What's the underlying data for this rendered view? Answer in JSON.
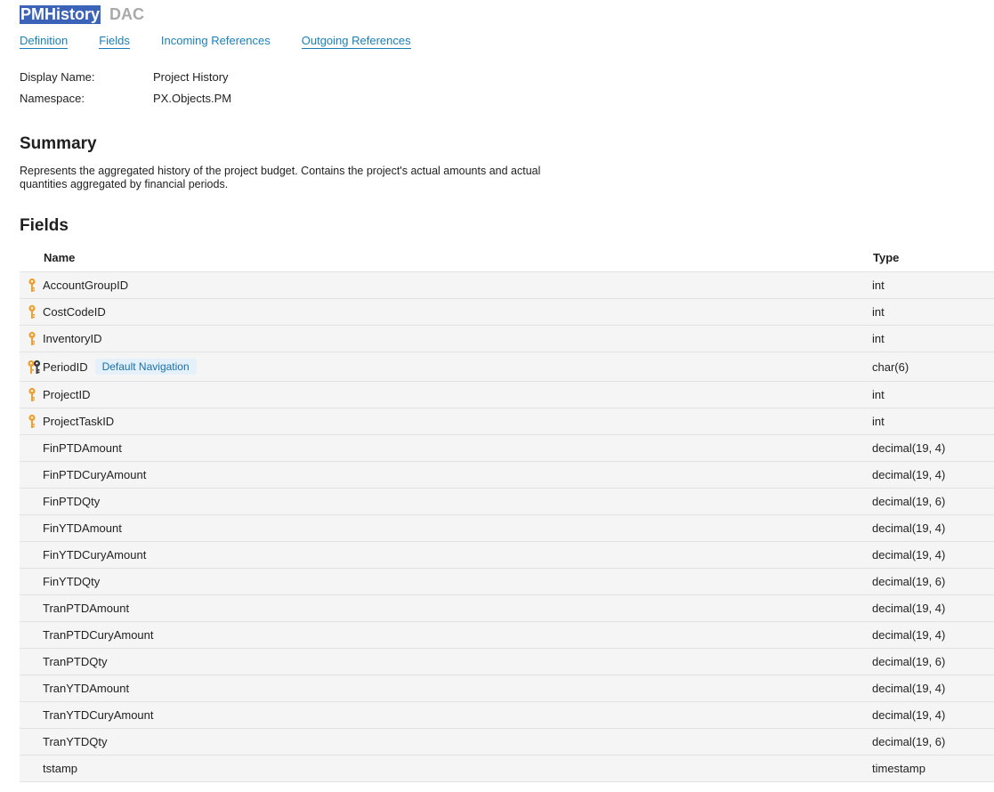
{
  "header": {
    "title": "PMHistory",
    "kind": "DAC"
  },
  "nav": [
    {
      "label": "Definition"
    },
    {
      "label": "Fields"
    },
    {
      "label": "Incoming References"
    },
    {
      "label": "Outgoing References"
    }
  ],
  "properties": {
    "display_name_label": "Display Name:",
    "display_name_value": "Project History",
    "namespace_label": "Namespace:",
    "namespace_value": "PX.Objects.PM"
  },
  "summary": {
    "heading": "Summary",
    "text": "Represents the aggregated history of the project budget. Contains the project's actual amounts and actual quantities aggregated by financial periods."
  },
  "fields": {
    "heading": "Fields",
    "columns": {
      "name": "Name",
      "type": "Type"
    },
    "rows": [
      {
        "name": "AccountGroupID",
        "type": "int",
        "key": "single"
      },
      {
        "name": "CostCodeID",
        "type": "int",
        "key": "single"
      },
      {
        "name": "InventoryID",
        "type": "int",
        "key": "single"
      },
      {
        "name": "PeriodID",
        "type": "char(6)",
        "key": "double",
        "badge": "Default Navigation"
      },
      {
        "name": "ProjectID",
        "type": "int",
        "key": "single"
      },
      {
        "name": "ProjectTaskID",
        "type": "int",
        "key": "single"
      },
      {
        "name": "FinPTDAmount",
        "type": "decimal(19, 4)"
      },
      {
        "name": "FinPTDCuryAmount",
        "type": "decimal(19, 4)"
      },
      {
        "name": "FinPTDQty",
        "type": "decimal(19, 6)"
      },
      {
        "name": "FinYTDAmount",
        "type": "decimal(19, 4)"
      },
      {
        "name": "FinYTDCuryAmount",
        "type": "decimal(19, 4)"
      },
      {
        "name": "FinYTDQty",
        "type": "decimal(19, 6)"
      },
      {
        "name": "TranPTDAmount",
        "type": "decimal(19, 4)"
      },
      {
        "name": "TranPTDCuryAmount",
        "type": "decimal(19, 4)"
      },
      {
        "name": "TranPTDQty",
        "type": "decimal(19, 6)"
      },
      {
        "name": "TranYTDAmount",
        "type": "decimal(19, 4)"
      },
      {
        "name": "TranYTDCuryAmount",
        "type": "decimal(19, 4)"
      },
      {
        "name": "TranYTDQty",
        "type": "decimal(19, 6)"
      },
      {
        "name": "tstamp",
        "type": "timestamp"
      }
    ]
  },
  "colors": {
    "link": "#1a7fb8",
    "title_highlight": "#3b63b8",
    "key_gold": "#f0a030",
    "key_dark": "#3a3a3a",
    "row_bg": "#f5f5f5"
  }
}
